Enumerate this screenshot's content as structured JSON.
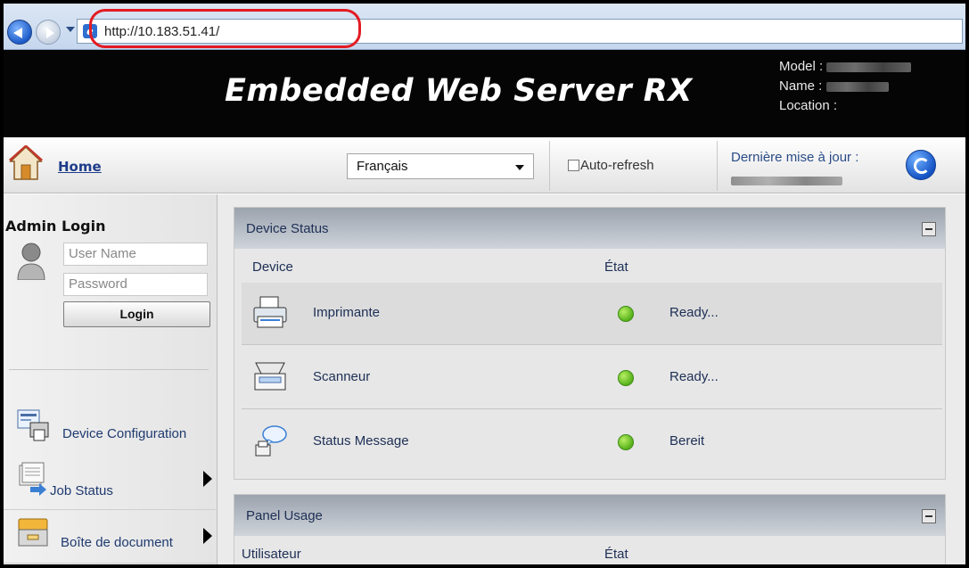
{
  "browser": {
    "url": "http://10.183.51.41/",
    "highlight_color": "#e31b23"
  },
  "header": {
    "title": "Embedded Web Server RX",
    "model_label": "Model :",
    "name_label": "Name :",
    "location_label": "Location :"
  },
  "toolbar": {
    "home_label": "Home",
    "language_selected": "Français",
    "auto_refresh_label": "Auto-refresh",
    "auto_refresh_checked": false,
    "last_update_label": "Dernière mise à jour :"
  },
  "sidebar": {
    "admin_title": "Admin Login",
    "username_placeholder": "User Name",
    "password_placeholder": "Password",
    "login_button": "Login",
    "menu": [
      {
        "label": "Device Configuration",
        "icon": "device-config-icon",
        "has_arrow": false
      },
      {
        "label": "Job Status",
        "icon": "job-status-icon",
        "has_arrow": true
      },
      {
        "label": "Boîte de document",
        "icon": "document-box-icon",
        "has_arrow": true
      }
    ]
  },
  "device_status": {
    "title": "Device Status",
    "col_device": "Device",
    "col_state": "État",
    "rows": [
      {
        "name": "Imprimante",
        "icon": "printer-icon",
        "status": "Ready...",
        "status_color": "#57b21b"
      },
      {
        "name": "Scanneur",
        "icon": "scanner-icon",
        "status": "Ready...",
        "status_color": "#57b21b"
      },
      {
        "name": "Status Message",
        "icon": "status-message-icon",
        "status": "Bereit",
        "status_color": "#57b21b"
      }
    ]
  },
  "panel_usage": {
    "title": "Panel Usage",
    "col_user": "Utilisateur",
    "col_state": "État"
  }
}
